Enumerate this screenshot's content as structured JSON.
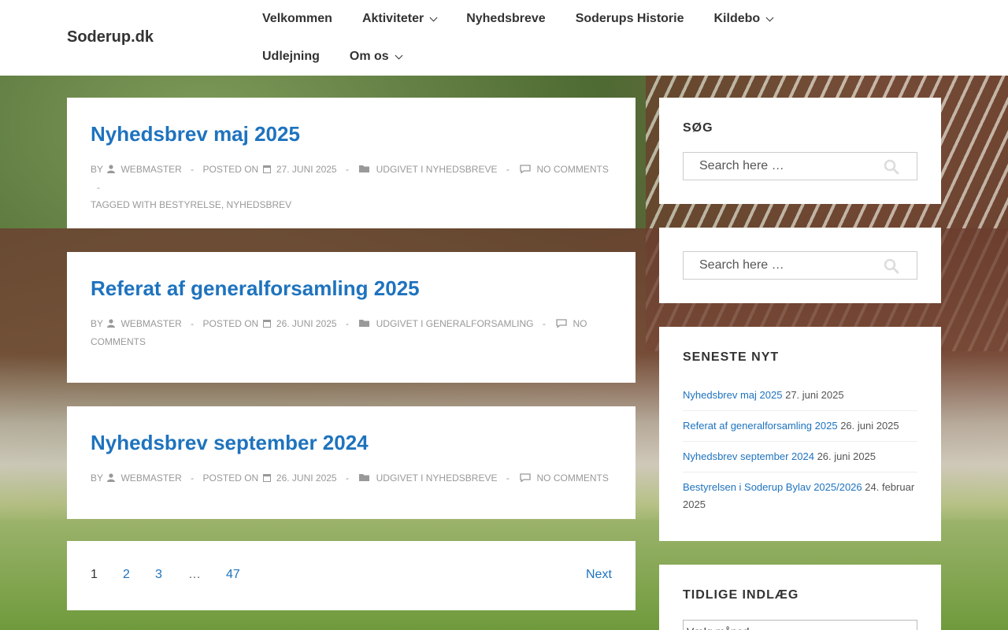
{
  "site": {
    "title": "Soderup.dk"
  },
  "nav": {
    "items": [
      {
        "label": "Velkommen"
      },
      {
        "label": "Aktiviteter",
        "dropdown": true
      },
      {
        "label": "Nyhedsbreve"
      },
      {
        "label": "Soderups Historie"
      },
      {
        "label": "Kildebo",
        "dropdown": true
      },
      {
        "label": "Udlejning"
      },
      {
        "label": "Om os",
        "dropdown": true
      }
    ]
  },
  "meta_labels": {
    "by": "BY",
    "posted_on": "POSTED ON",
    "tagged_with": "TAGGED WITH"
  },
  "posts": [
    {
      "title": "Nyhedsbrev maj 2025",
      "author": "WEBMASTER",
      "date": "27. JUNI 2025",
      "category": "UDGIVET I NYHEDSBREVE",
      "comments": "NO COMMENTS",
      "tags": [
        "BESTYRELSE",
        "NYHEDSBREV"
      ]
    },
    {
      "title": "Referat af generalforsamling 2025",
      "author": "WEBMASTER",
      "date": "26. JUNI 2025",
      "category": "UDGIVET I GENERALFORSAMLING",
      "comments_a": "NO",
      "comments_b": "COMMENTS"
    },
    {
      "title": "Nyhedsbrev september 2024",
      "author": "WEBMASTER",
      "date": "26. JUNI 2025",
      "category": "UDGIVET I NYHEDSBREVE",
      "comments": "NO COMMENTS"
    }
  ],
  "pagination": {
    "pages": [
      "1",
      "2",
      "3",
      "…",
      "47"
    ],
    "current": "1",
    "next": "Next"
  },
  "sidebar": {
    "search_title": "SØG",
    "search_placeholder": "Search here …",
    "recent_title": "SENESTE NYT",
    "recent": [
      {
        "title": "Nyhedsbrev maj 2025",
        "date": "27. juni 2025"
      },
      {
        "title": "Referat af generalforsamling 2025",
        "date": "26. juni 2025"
      },
      {
        "title": "Nyhedsbrev september 2024",
        "date": "26. juni 2025"
      },
      {
        "title": "Bestyrelsen i Soderup Bylav 2025/2026",
        "date": "24. februar 2025"
      }
    ],
    "archive_title": "TIDLIGE INDLÆG",
    "archive_select": "Vælg måned"
  },
  "colors": {
    "link": "#1e73be",
    "meta": "#999999",
    "text": "#333333"
  }
}
